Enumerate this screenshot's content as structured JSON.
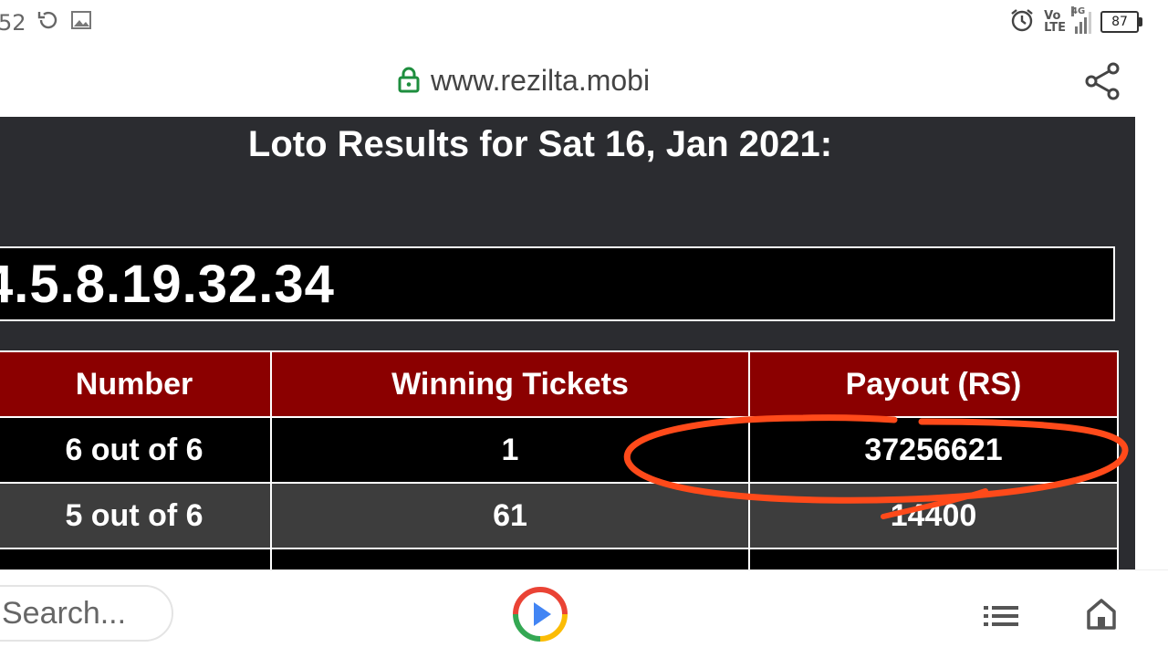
{
  "status_bar": {
    "time_fragment": "52",
    "network": {
      "volte_top": "Vo",
      "volte_bottom": "LTE",
      "generation": "4G"
    },
    "battery": "87"
  },
  "address_bar": {
    "url": "www.rezilta.mobi"
  },
  "page": {
    "title": "Loto Results for Sat 16, Jan 2021:",
    "winning_numbers": "4.5.8.19.32.34",
    "table": {
      "headers": [
        "Number",
        "Winning Tickets",
        "Payout (RS)"
      ],
      "rows": [
        [
          "6 out of 6",
          "1",
          "37256621"
        ],
        [
          "5 out of 6",
          "61",
          "14400"
        ],
        [
          "",
          "",
          ""
        ]
      ]
    }
  },
  "bottom_bar": {
    "search_placeholder": "Search..."
  },
  "colors": {
    "page_background": "#2b2c30",
    "header_red": "#8b0000",
    "annotation_orange": "#ff4a1a"
  }
}
